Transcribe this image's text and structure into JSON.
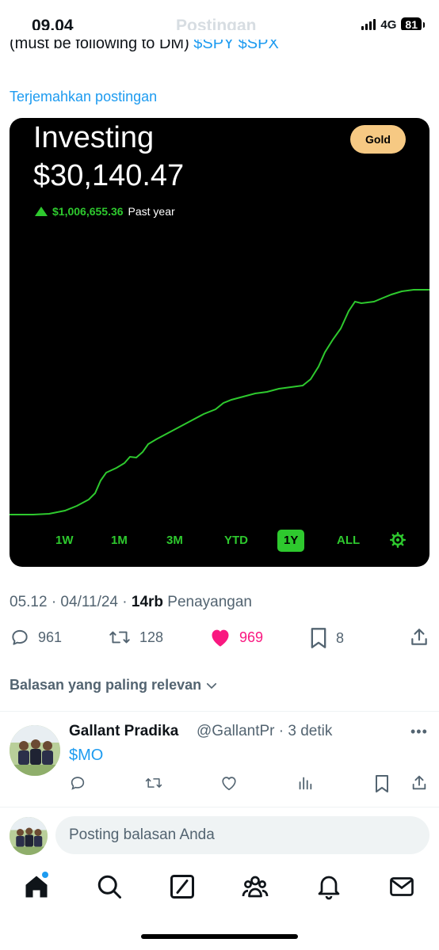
{
  "status_bar": {
    "time": "09.04",
    "network": "4G",
    "battery": "81"
  },
  "header": {
    "title": "Postingan"
  },
  "post": {
    "text_partial": "(must be following to DM) ",
    "cashtags": "$SPY $SPX",
    "translate_label": "Terjemahkan postingan",
    "media": {
      "title": "Investing",
      "value": "$30,140.47",
      "change_value": "$1,006,655.36",
      "change_label": "Past year",
      "badge": "Gold",
      "ranges": [
        "1W",
        "1M",
        "3M",
        "YTD",
        "1Y",
        "ALL"
      ],
      "active_range": "1Y",
      "accent_color": "#2ec92e",
      "badge_color": "#f6c983"
    },
    "meta": {
      "time_date": "05.12 · 04/11/24 · ",
      "views_count": "14rb",
      "views_label": " Penayangan"
    },
    "stats": {
      "replies": "961",
      "reposts": "128",
      "likes": "969",
      "bookmarks": "8"
    }
  },
  "replies_section": {
    "sort_label": "Balasan yang paling relevan",
    "reply": {
      "name": "Gallant Pradika",
      "handle": "@GallantPr · 3 detik",
      "text": "$MO"
    }
  },
  "compose": {
    "placeholder": "Posting balasan Anda"
  },
  "nav": {
    "icons": [
      "home-icon",
      "search-icon",
      "grok-icon",
      "communities-icon",
      "notifications-icon",
      "messages-icon"
    ]
  },
  "colors": {
    "link": "#1d9bf0",
    "like": "#f91880",
    "muted": "#536471"
  }
}
